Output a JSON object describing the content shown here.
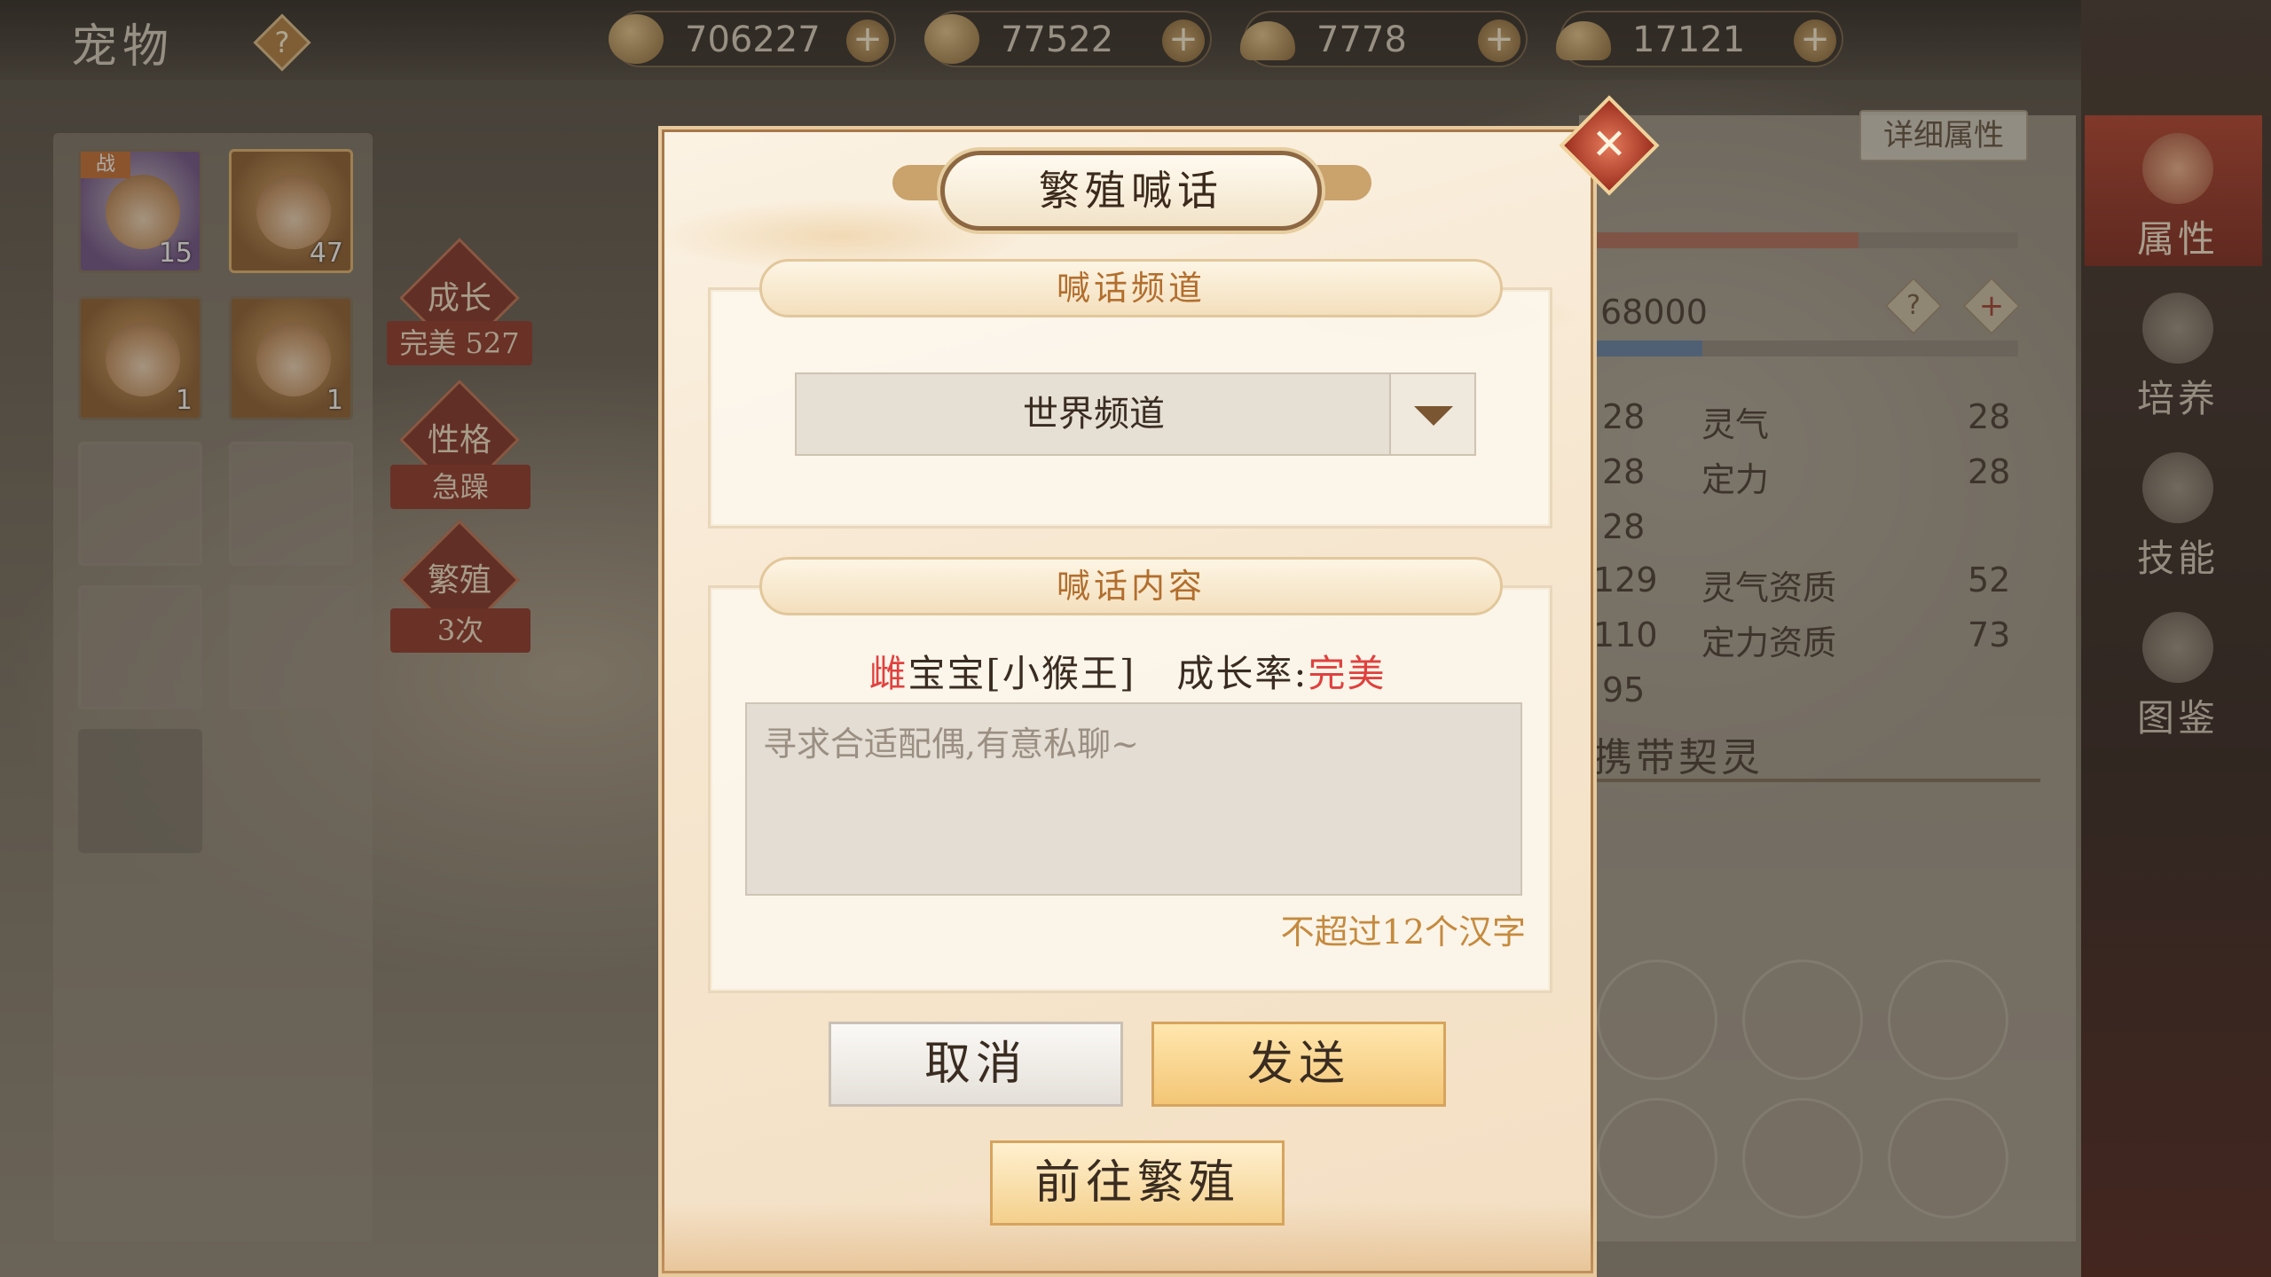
{
  "screen": {
    "title": "宠物",
    "help_label": "?"
  },
  "currencies": [
    {
      "icon": "copper-coin-icon",
      "value": "706227"
    },
    {
      "icon": "gold-coin-icon",
      "value": "77522"
    },
    {
      "icon": "silver-ingot-icon",
      "value": "7778"
    },
    {
      "icon": "gold-ingot-icon",
      "value": "17121"
    }
  ],
  "pets": [
    {
      "level": "15",
      "badge": "战"
    },
    {
      "level": "47"
    },
    {
      "level": "1"
    },
    {
      "level": "1"
    }
  ],
  "side_tags": {
    "growth_title": "成长",
    "growth_value": "完美 527",
    "personality_title": "性格",
    "personality_value": "急躁",
    "breed_title": "繁殖",
    "breed_value": "3次"
  },
  "right_panel": {
    "detail_button": "详细属性",
    "hp_value": "68000",
    "help_label": "?",
    "add_label": "+",
    "stats": [
      {
        "left": "28",
        "name": "灵气",
        "value": "28"
      },
      {
        "left": "28",
        "name": "定力",
        "value": "28"
      },
      {
        "left": "28",
        "name": "",
        "value": ""
      },
      {
        "left": "129",
        "name": "灵气资质",
        "value": "52"
      },
      {
        "left": "110",
        "name": "定力资质",
        "value": "73"
      },
      {
        "left": "95",
        "name": "",
        "value": ""
      }
    ],
    "carry_label": "携带契灵"
  },
  "nav": [
    {
      "label": "属性",
      "active": true
    },
    {
      "label": "培养"
    },
    {
      "label": "技能"
    },
    {
      "label": "图鉴"
    }
  ],
  "dialog": {
    "title": "繁殖喊话",
    "close_label": "✕",
    "channel_section": "喊话频道",
    "channel_value": "世界频道",
    "content_section": "喊话内容",
    "pet_gender": "雌",
    "pet_name": "宝宝[小猴王]",
    "growth_label": "成长率:",
    "growth_value": "完美",
    "input_placeholder": "寻求合适配偶,有意私聊~",
    "input_value": "",
    "char_limit": "不超过12个汉字",
    "cancel_label": "取消",
    "send_label": "发送",
    "goto_breed_label": "前往繁殖"
  },
  "colors": {
    "accent_red": "#e0413e",
    "section_header_text": "#b26e2e",
    "send_button": "#f3c676"
  }
}
